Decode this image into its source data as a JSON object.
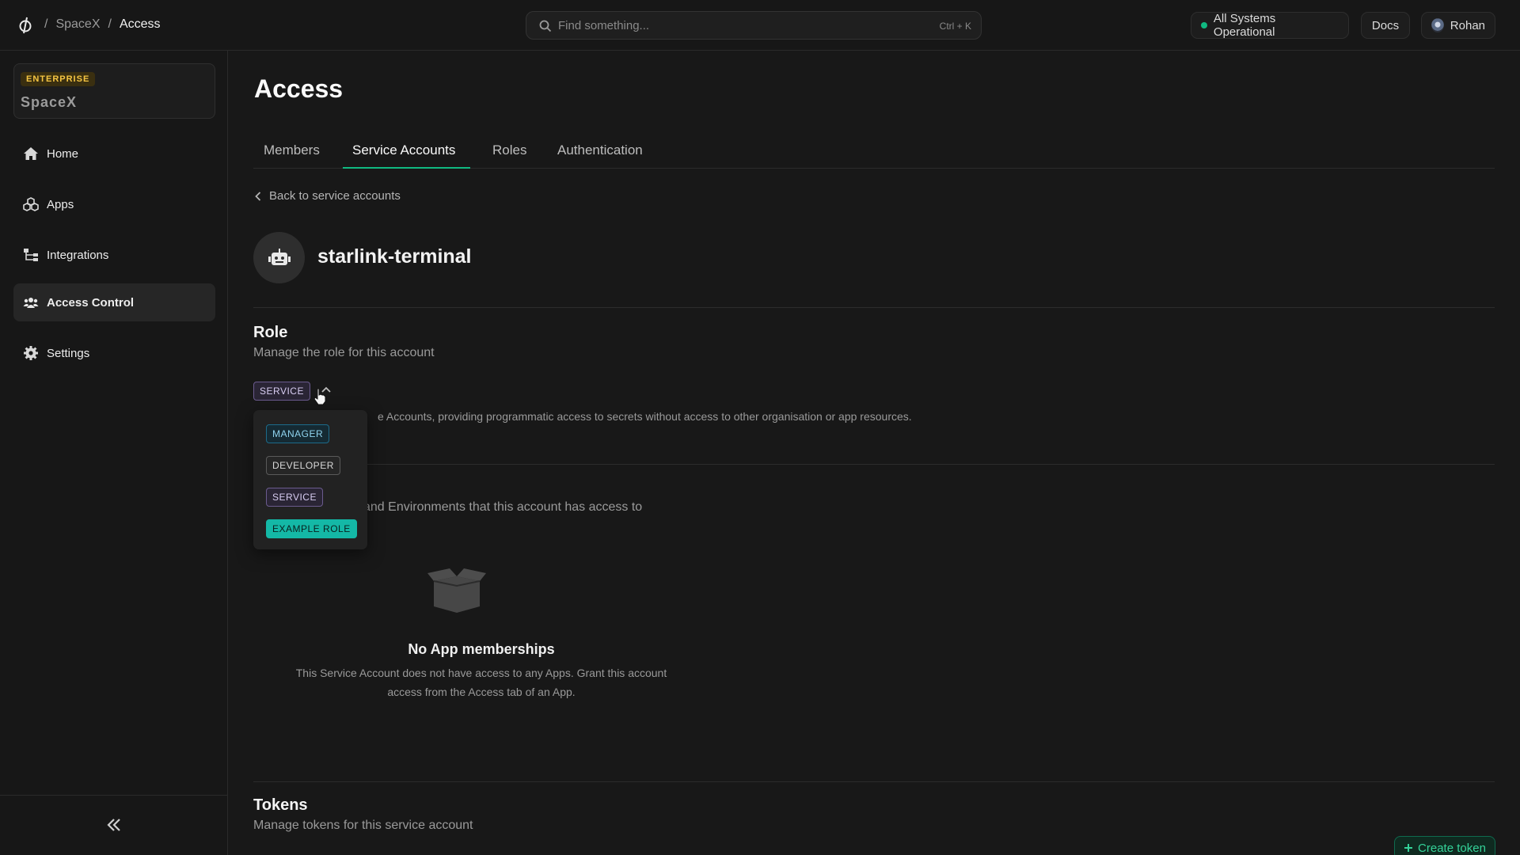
{
  "topbar": {
    "breadcrumb": [
      "SpaceX",
      "Access"
    ],
    "separator": "/",
    "search_placeholder": "Find something...",
    "search_shortcut": "Ctrl + K",
    "status": "All Systems Operational",
    "docs": "Docs",
    "user": "Rohan"
  },
  "sidebar": {
    "org_badge": "ENTERPRISE",
    "org_name": "SpaceX",
    "items": [
      {
        "label": "Home",
        "icon": "home-icon"
      },
      {
        "label": "Apps",
        "icon": "apps-icon"
      },
      {
        "label": "Integrations",
        "icon": "integrations-icon"
      },
      {
        "label": "Access Control",
        "icon": "users-icon",
        "active": true
      },
      {
        "label": "Settings",
        "icon": "gear-icon"
      }
    ]
  },
  "main": {
    "title": "Access",
    "tabs": [
      "Members",
      "Service Accounts",
      "Roles",
      "Authentication"
    ],
    "active_tab": "Service Accounts",
    "back_link": "Back to service accounts",
    "account_name": "starlink-terminal",
    "role_section": {
      "title": "Role",
      "subtitle": "Manage the role for this account",
      "current_role": "SERVICE",
      "description_visible": "e Accounts, providing programmatic access to secrets without access to other organisation or app resources."
    },
    "role_menu": [
      "MANAGER",
      "DEVELOPER",
      "SERVICE",
      "EXAMPLE ROLE"
    ],
    "apps_section": {
      "subtitle_visible": "and Environments that this account has access to",
      "empty_title": "No App memberships",
      "empty_text": "This Service Account does not have access to any Apps. Grant this account access from the Access tab of an App."
    },
    "tokens_section": {
      "title": "Tokens",
      "subtitle": "Manage tokens for this service account",
      "create_label": "Create token"
    }
  },
  "colors": {
    "accent": "#10b981",
    "enterprise_badge": "#f5c542",
    "example_role": "#14b8a6"
  }
}
